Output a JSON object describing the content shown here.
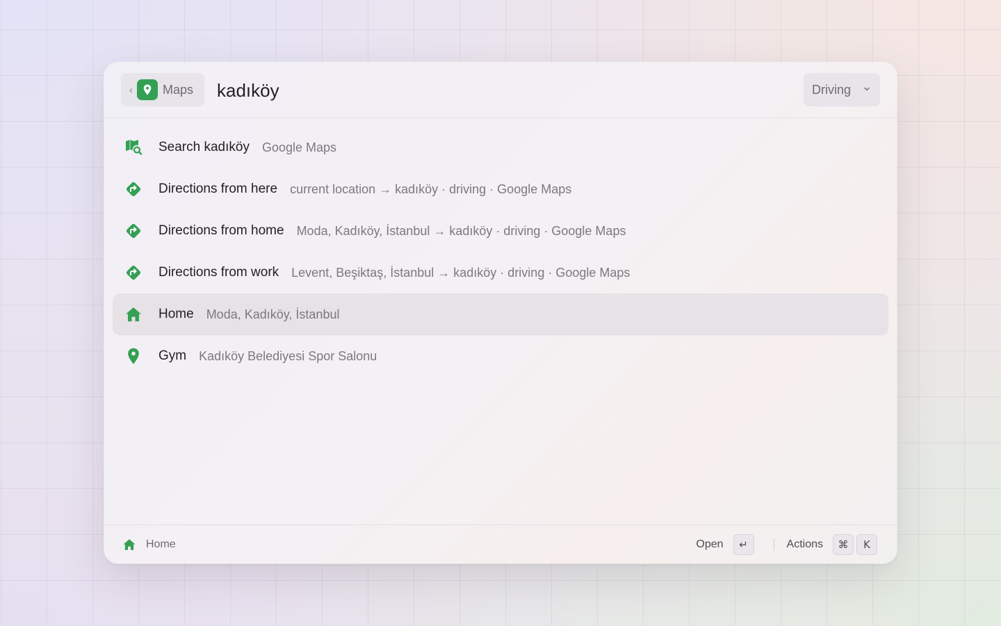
{
  "header": {
    "back_chip": {
      "chevron": "‹",
      "app_name": "Maps"
    },
    "search": {
      "value": "kadıköy"
    },
    "mode": {
      "label": "Driving"
    }
  },
  "results": [
    {
      "icon": "map-search-icon",
      "title": "Search kadıköy",
      "subtitle": "Google Maps"
    },
    {
      "icon": "directions-icon",
      "title": "Directions from here",
      "subtitle": "current location → kadıköy · driving · Google Maps"
    },
    {
      "icon": "directions-icon",
      "title": "Directions from home",
      "subtitle": "Moda, Kadıköy, İstanbul → kadıköy · driving · Google Maps"
    },
    {
      "icon": "directions-icon",
      "title": "Directions from work",
      "subtitle": "Levent, Beşiktaş, İstanbul → kadıköy · driving · Google Maps"
    },
    {
      "icon": "home-icon",
      "title": "Home",
      "subtitle": "Moda, Kadıköy, İstanbul",
      "selected": true
    },
    {
      "icon": "pin-icon",
      "title": "Gym",
      "subtitle": "Kadıköy Belediyesi Spor Salonu"
    }
  ],
  "footer": {
    "selected_label": "Home",
    "primary_action": {
      "label": "Open",
      "key": "↵"
    },
    "actions": {
      "label": "Actions",
      "keys": [
        "⌘",
        "K"
      ]
    }
  },
  "colors": {
    "accent_green": "#34a054",
    "selected_row": "#e6e2e6"
  }
}
